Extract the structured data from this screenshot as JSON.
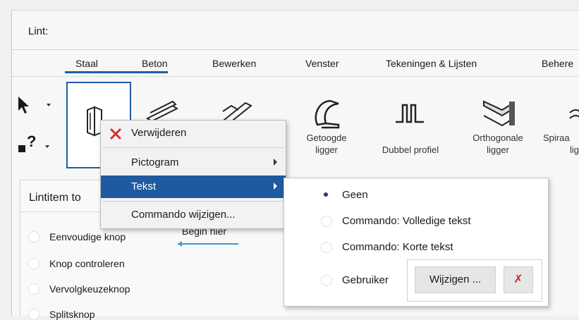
{
  "ribbon": {
    "label": "Lint:",
    "tabs": [
      "Staal",
      "Beton",
      "Bewerken",
      "Venster",
      "Tekeningen & Lijsten",
      "Behere"
    ],
    "tools": [
      {
        "label_line1": "Getoogde",
        "label_line2": "ligger",
        "icon": "curved-beam-icon"
      },
      {
        "label_line1": "",
        "label_line2": "Dubbel profiel",
        "icon": "double-profile-icon"
      },
      {
        "label_line1": "Orthogonale",
        "label_line2": "ligger",
        "icon": "orthogonal-beam-icon"
      },
      {
        "label_line1": "Spiraa",
        "label_line2": "lig",
        "icon": "spiral-beam-icon"
      }
    ]
  },
  "lower": {
    "heading": "Lintitem to",
    "options": [
      "Eenvoudige knop",
      "Knop controleren",
      "Vervolgkeuzeknop",
      "Splitsknop"
    ],
    "hint": "Begin hier"
  },
  "context_menu": {
    "items": [
      {
        "label": "Verwijderen",
        "icon": "delete-x-icon"
      },
      {
        "label": "Pictogram",
        "has_submenu": true
      },
      {
        "label": "Tekst",
        "has_submenu": true,
        "highlighted": true
      },
      {
        "label": "Commando wijzigen..."
      }
    ]
  },
  "submenu": {
    "options": [
      {
        "label": "Geen",
        "selected": true
      },
      {
        "label": "Commando: Volledige tekst",
        "selected": false
      },
      {
        "label": "Commando: Korte tekst",
        "selected": false
      },
      {
        "label": "Gebruiker",
        "selected": false
      }
    ],
    "edit_button": "Wijzigen ...",
    "clear_button": "✗"
  },
  "colors": {
    "accent": "#1d5a9f",
    "delete": "#d32f2f",
    "hint_arrow": "#3a9ad9"
  }
}
